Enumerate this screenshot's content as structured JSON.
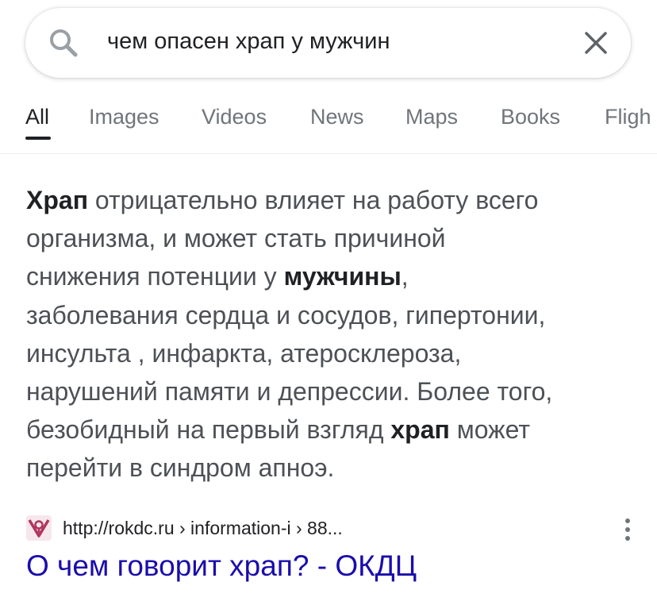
{
  "search": {
    "query": "чем опасен храп у мужчин",
    "search_icon": "search-icon",
    "clear_icon": "close-icon"
  },
  "tabs": [
    {
      "label": "All",
      "active": true
    },
    {
      "label": "Images",
      "active": false
    },
    {
      "label": "Videos",
      "active": false
    },
    {
      "label": "News",
      "active": false
    },
    {
      "label": "Maps",
      "active": false
    },
    {
      "label": "Books",
      "active": false
    },
    {
      "label": "Fligh",
      "active": false
    }
  ],
  "snippet": {
    "lines": [
      [
        {
          "t": "Храп",
          "b": true
        },
        {
          "t": " отрицательно влияет на работу всего",
          "b": false
        }
      ],
      [
        {
          "t": "организма, и может стать причиной",
          "b": false
        }
      ],
      [
        {
          "t": "снижения потенции у ",
          "b": false
        },
        {
          "t": "мужчины",
          "b": true
        },
        {
          "t": ",",
          "b": false
        }
      ],
      [
        {
          "t": "заболевания сердца и сосудов, гипертонии,",
          "b": false
        }
      ],
      [
        {
          "t": "инсульта , инфаркта, атеросклероза,",
          "b": false
        }
      ],
      [
        {
          "t": "нарушений памяти и депрессии. Более того,",
          "b": false
        }
      ],
      [
        {
          "t": "безобидный на первый взгляд ",
          "b": false
        },
        {
          "t": "храп",
          "b": true
        },
        {
          "t": " может",
          "b": false
        }
      ],
      [
        {
          "t": "перейти в синдром апноэ.",
          "b": false
        }
      ]
    ]
  },
  "result": {
    "breadcrumb": "http://rokdc.ru › information-i › 88...",
    "favicon": "site-logo-icon",
    "title": "О чем говорит храп? - ОКДЦ",
    "more_icon": "more-vert-icon"
  },
  "colors": {
    "link": "#1a0dab",
    "snippet_text": "#4d5156",
    "tab_inactive": "#70757a",
    "favicon_accent": "#b0365e"
  }
}
